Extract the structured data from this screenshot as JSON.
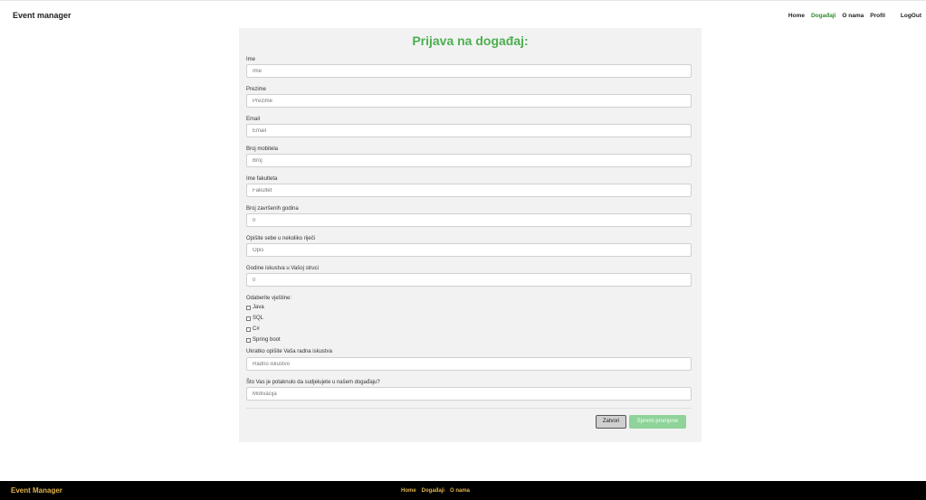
{
  "header": {
    "brand": "Event manager",
    "nav": [
      "Home",
      "Događaji",
      "O nama",
      "Profil"
    ],
    "logout": "LogOut"
  },
  "form": {
    "title": "Prijava na događaj:",
    "fields": [
      {
        "label": "Ime",
        "placeholder": "Ime"
      },
      {
        "label": "Prezime",
        "placeholder": "Prezime"
      },
      {
        "label": "Email",
        "placeholder": "Email"
      },
      {
        "label": "Broj mobitela",
        "placeholder": "Broj"
      },
      {
        "label": "Ime fakulteta",
        "placeholder": "Fakultet"
      },
      {
        "label": "Broj završenih godina",
        "value": "0"
      },
      {
        "label": "Opišite sebe u nekoliko riječi",
        "placeholder": "Opis"
      },
      {
        "label": "Godine iskustva u Vašoj struci",
        "value": "0"
      }
    ],
    "skills_label": "Odaberite vještine:",
    "skills": [
      "Java",
      "SQL",
      "C#",
      "Spring boot"
    ],
    "experience": {
      "label": "Ukratko opišite Vaša radna iskustva",
      "placeholder": "Radno iskustvo"
    },
    "motivation": {
      "label": "Što Vas je potaknulo da sudjelujete u našem događaju?",
      "placeholder": "Motivacija"
    },
    "close_label": "Zatvori",
    "save_label": "Spremi promjene"
  },
  "footer": {
    "brand": "Event Manager",
    "nav": [
      "Home",
      "Događaji",
      "O nama"
    ]
  }
}
